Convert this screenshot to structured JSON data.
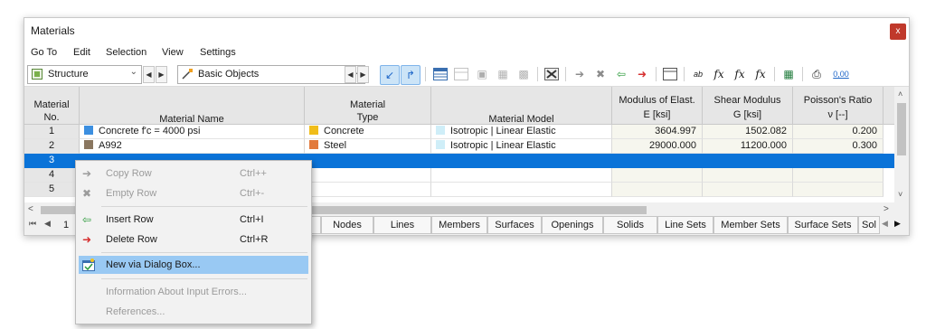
{
  "window": {
    "title": "Materials",
    "close": "x"
  },
  "menu": [
    "Go To",
    "Edit",
    "Selection",
    "View",
    "Settings"
  ],
  "toolbar": {
    "combo1": "Structure",
    "combo2": "Basic Objects",
    "decimals_label": "0,00"
  },
  "columns": {
    "no": [
      "Material",
      "No."
    ],
    "name": "Material Name",
    "type": [
      "Material",
      "Type"
    ],
    "model": "Material Model",
    "e": [
      "Modulus of Elast.",
      "E [ksi]"
    ],
    "g": [
      "Shear Modulus",
      "G [ksi]"
    ],
    "nu": [
      "Poisson's Ratio",
      "ν [--]"
    ]
  },
  "rows": [
    {
      "no": "1",
      "name": "Concrete f'c = 4000 psi",
      "name_color": "#3c8fe0",
      "type": "Concrete",
      "type_color": "#f0bd1a",
      "model": "Isotropic | Linear Elastic",
      "model_color": "#cfeef8",
      "e": "3604.997",
      "g": "1502.082",
      "nu": "0.200"
    },
    {
      "no": "2",
      "name": "A992",
      "name_color": "#8a7760",
      "type": "Steel",
      "type_color": "#e27a3c",
      "model": "Isotropic | Linear Elastic",
      "model_color": "#cfeef8",
      "e": "29000.000",
      "g": "11200.000",
      "nu": "0.300"
    },
    {
      "no": "3"
    },
    {
      "no": "4"
    },
    {
      "no": "5"
    }
  ],
  "pager": "1",
  "tabs": [
    "Nodes",
    "Lines",
    "Members",
    "Surfaces",
    "Openings",
    "Solids",
    "Line Sets",
    "Member Sets",
    "Surface Sets",
    "Sol"
  ],
  "context_menu": {
    "copy_row": {
      "label": "Copy Row",
      "shortcut": "Ctrl++"
    },
    "empty_row": {
      "label": "Empty Row",
      "shortcut": "Ctrl+-"
    },
    "insert_row": {
      "label": "Insert Row",
      "shortcut": "Ctrl+I"
    },
    "delete_row": {
      "label": "Delete Row",
      "shortcut": "Ctrl+R"
    },
    "new_dialog": {
      "label": "New via Dialog Box..."
    },
    "info_errors": {
      "label": "Information About Input Errors..."
    },
    "references": {
      "label": "References..."
    }
  }
}
